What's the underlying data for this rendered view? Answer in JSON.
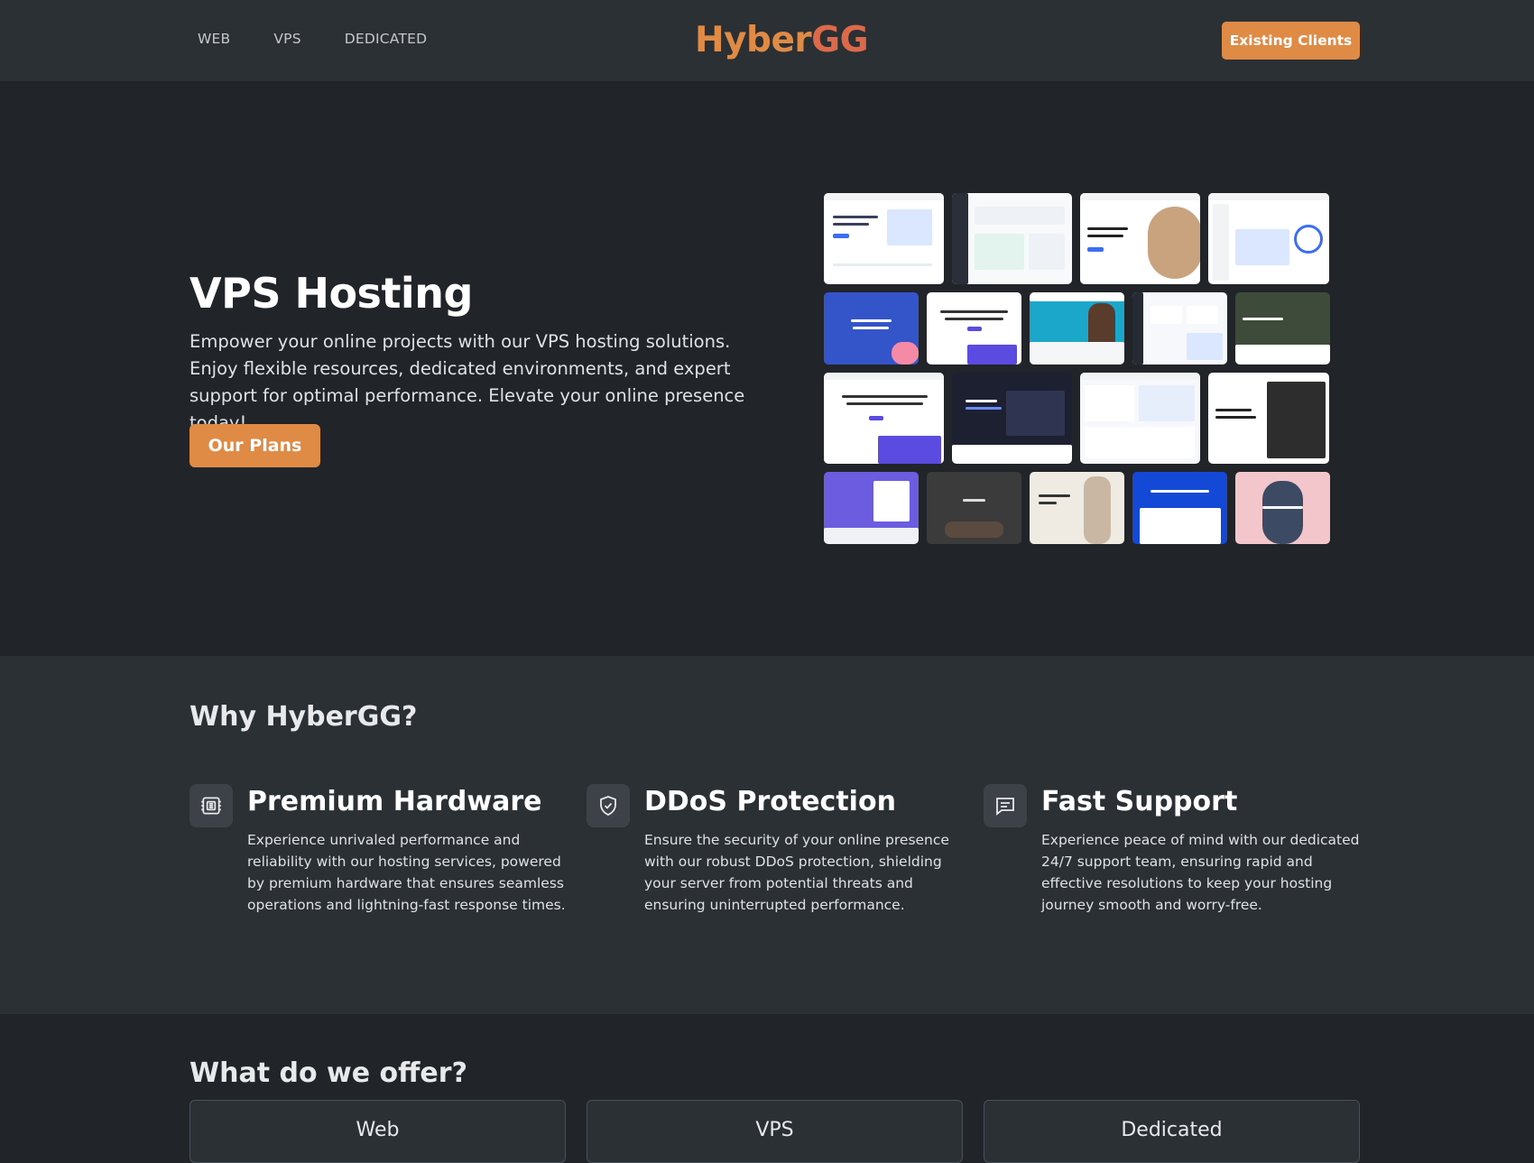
{
  "navbar": {
    "links": [
      "WEB",
      "VPS",
      "DEDICATED"
    ],
    "logo": {
      "part1": "Hyber",
      "part2": "GG"
    },
    "existing_clients": "Existing Clients"
  },
  "hero": {
    "title": "VPS Hosting",
    "description": "Empower your online projects with our VPS hosting solutions. Enjoy flexible resources, dedicated environments, and expert support for optimal performance. Elevate your online presence today!",
    "cta": "Our Plans"
  },
  "why": {
    "title": "Why HyberGG?",
    "features": [
      {
        "icon": "hardware-chip-icon",
        "title": "Premium Hardware",
        "text": "Experience unrivaled performance and reliability with our hosting services, powered by premium hardware that ensures seamless operations and lightning-fast response times."
      },
      {
        "icon": "shield-check-icon",
        "title": "DDoS Protection",
        "text": "Ensure the security of your online presence with our robust DDoS protection, shielding your server from potential threats and ensuring uninterrupted performance."
      },
      {
        "icon": "chat-message-icon",
        "title": "Fast Support",
        "text": "Experience peace of mind with our dedicated 24/7 support team, ensuring rapid and effective resolutions to keep your hosting journey smooth and worry-free."
      }
    ]
  },
  "offer": {
    "title": "What do we offer?",
    "cards": [
      "Web",
      "VPS",
      "Dedicated"
    ]
  },
  "colors": {
    "accent": "#e08b45",
    "background": "#212529",
    "surface": "#2b3035"
  }
}
